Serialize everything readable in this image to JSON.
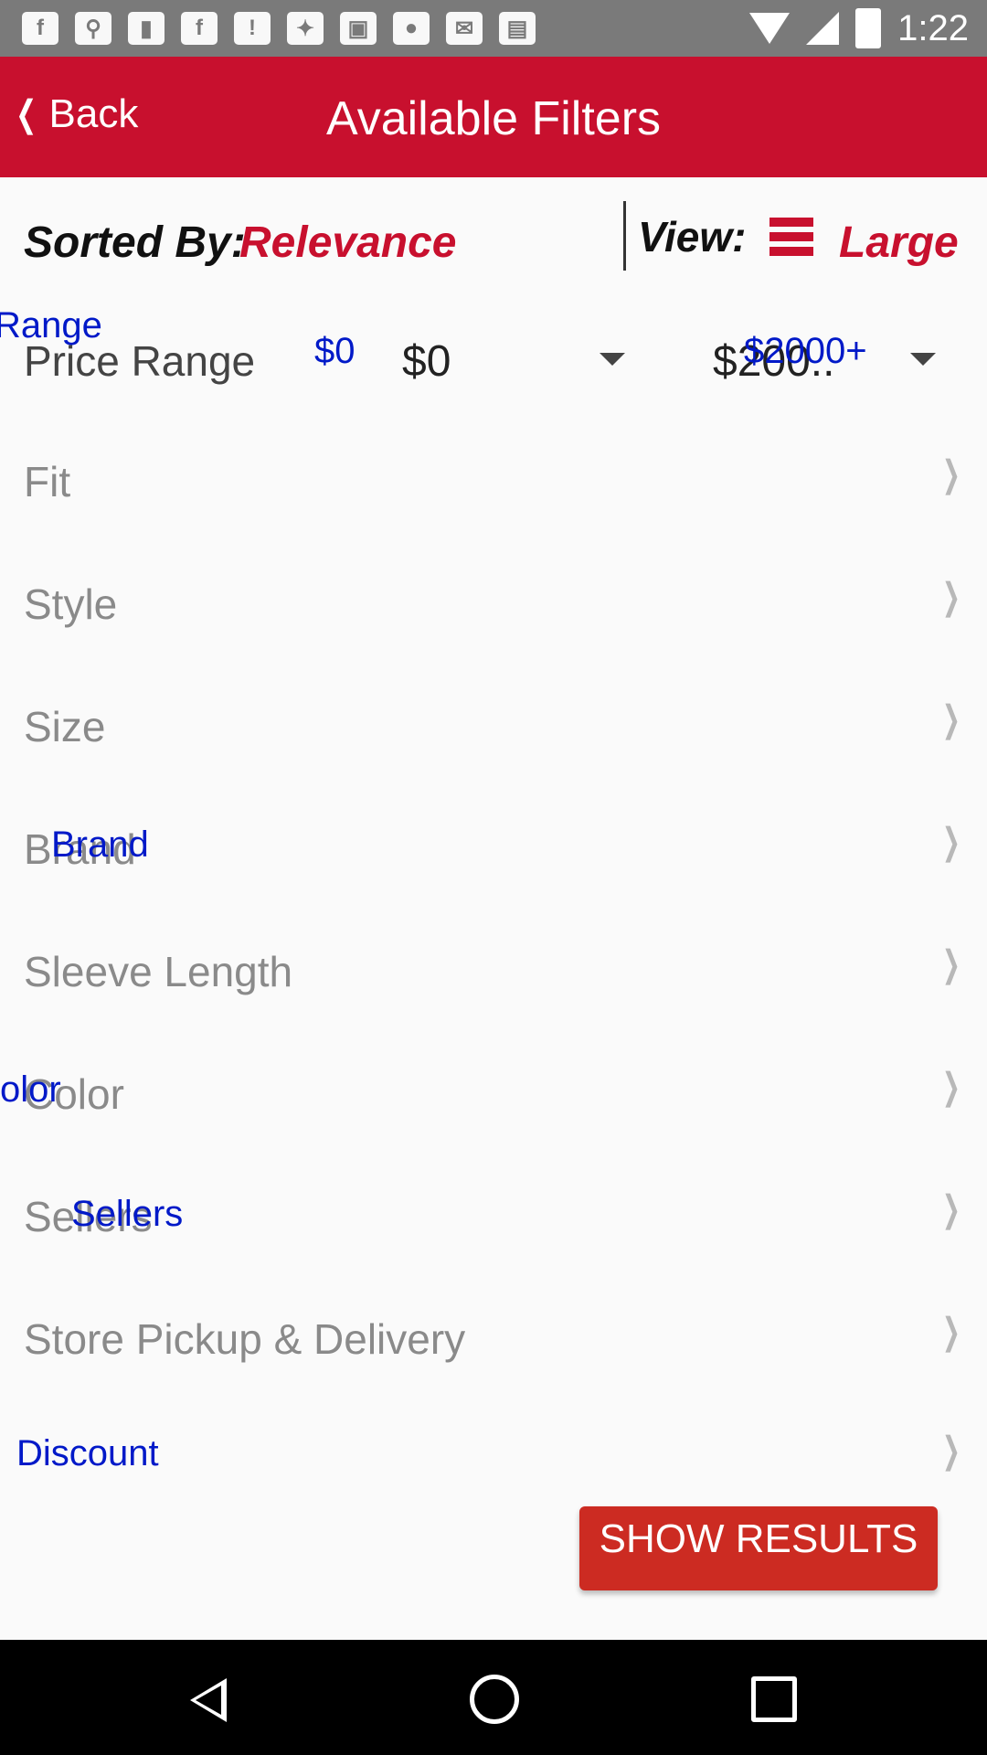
{
  "status_bar": {
    "time": "1:22",
    "notification_icons": [
      "facebook-icon",
      "pin-icon",
      "sim-icon",
      "facebook-icon",
      "alert-icon",
      "fake-gps-icon",
      "lock-icon",
      "app-icon",
      "checkmail-icon",
      "bag-icon"
    ]
  },
  "header": {
    "back_label": "Back",
    "title": "Available Filters"
  },
  "sort_bar": {
    "sorted_by_label": "Sorted By:",
    "sorted_by_value": "Relevance",
    "view_label": "View:",
    "view_value": "Large"
  },
  "price_range": {
    "label": "Price Range",
    "overlay_label": "Range",
    "min_badge": "$0",
    "min_value": "$0",
    "max_value": "$200..",
    "max_badge": "$2000+"
  },
  "filters": [
    {
      "label": "Fit"
    },
    {
      "label": "Style"
    },
    {
      "label": "Size"
    },
    {
      "label": "Brand",
      "overlay": "Brand"
    },
    {
      "label": "Sleeve Length"
    },
    {
      "label": "Color",
      "overlay": "olor"
    },
    {
      "label": "Sellers",
      "overlay": "Sellers"
    },
    {
      "label": "Store Pickup & Delivery"
    },
    {
      "label": "Discount",
      "overlay": "Discount"
    }
  ],
  "show_button": {
    "label": "SHOW RESULTS"
  },
  "colors": {
    "brand_red": "#c8102e",
    "overlay_blue": "#0019c8",
    "button_red": "#cc2b22"
  }
}
